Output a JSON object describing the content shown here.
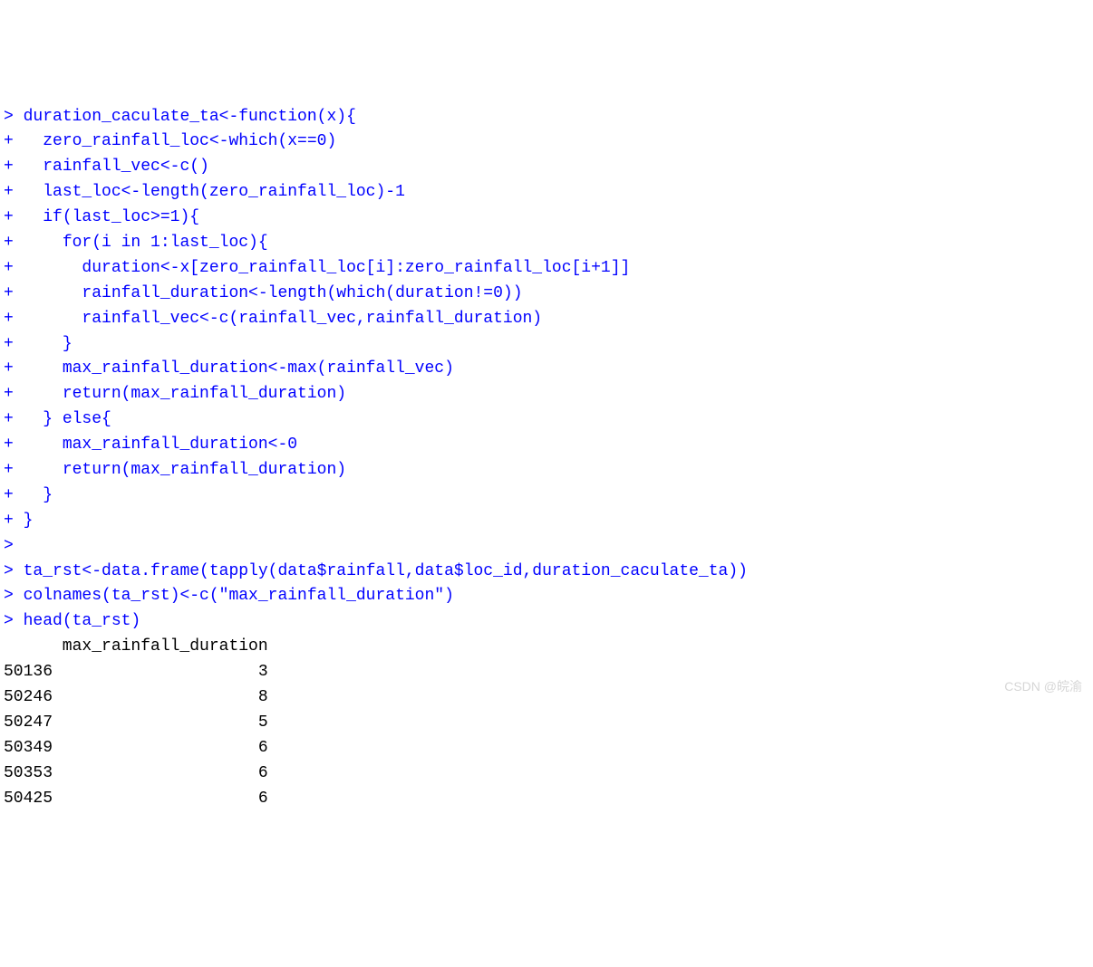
{
  "console": {
    "lines": [
      {
        "prompt": "> ",
        "code": "duration_caculate_ta<-function(x){",
        "output": ""
      },
      {
        "prompt": "+ ",
        "code": "  zero_rainfall_loc<-which(x==0)",
        "output": ""
      },
      {
        "prompt": "+ ",
        "code": "  rainfall_vec<-c()",
        "output": ""
      },
      {
        "prompt": "+ ",
        "code": "  last_loc<-length(zero_rainfall_loc)-1",
        "output": ""
      },
      {
        "prompt": "+ ",
        "code": "  if(last_loc>=1){",
        "output": ""
      },
      {
        "prompt": "+ ",
        "code": "    for(i in 1:last_loc){",
        "output": ""
      },
      {
        "prompt": "+ ",
        "code": "      duration<-x[zero_rainfall_loc[i]:zero_rainfall_loc[i+1]]",
        "output": ""
      },
      {
        "prompt": "+ ",
        "code": "      rainfall_duration<-length(which(duration!=0))",
        "output": ""
      },
      {
        "prompt": "+ ",
        "code": "      rainfall_vec<-c(rainfall_vec,rainfall_duration)",
        "output": ""
      },
      {
        "prompt": "+ ",
        "code": "    }",
        "output": ""
      },
      {
        "prompt": "+ ",
        "code": "    max_rainfall_duration<-max(rainfall_vec)",
        "output": ""
      },
      {
        "prompt": "+ ",
        "code": "    return(max_rainfall_duration)",
        "output": ""
      },
      {
        "prompt": "+ ",
        "code": "  } else{",
        "output": ""
      },
      {
        "prompt": "+ ",
        "code": "    max_rainfall_duration<-0",
        "output": ""
      },
      {
        "prompt": "+ ",
        "code": "    return(max_rainfall_duration)",
        "output": ""
      },
      {
        "prompt": "+ ",
        "code": "  }",
        "output": ""
      },
      {
        "prompt": "+ ",
        "code": "}",
        "output": ""
      },
      {
        "prompt": "> ",
        "code": "",
        "output": ""
      },
      {
        "prompt": "> ",
        "code": "ta_rst<-data.frame(tapply(data$rainfall,data$loc_id,duration_caculate_ta))",
        "output": ""
      },
      {
        "prompt": "> ",
        "code": "colnames(ta_rst)<-c(\"max_rainfall_duration\")",
        "output": ""
      },
      {
        "prompt": "> ",
        "code": "head(ta_rst)",
        "output": ""
      },
      {
        "prompt": "",
        "code": "",
        "output": "      max_rainfall_duration"
      },
      {
        "prompt": "",
        "code": "",
        "output": "50136                     3"
      },
      {
        "prompt": "",
        "code": "",
        "output": "50246                     8"
      },
      {
        "prompt": "",
        "code": "",
        "output": "50247                     5"
      },
      {
        "prompt": "",
        "code": "",
        "output": "50349                     6"
      },
      {
        "prompt": "",
        "code": "",
        "output": "50353                     6"
      },
      {
        "prompt": "",
        "code": "",
        "output": "50425                     6"
      }
    ]
  },
  "chart_data": {
    "type": "table",
    "title": "head(ta_rst)",
    "columns": [
      "",
      "max_rainfall_duration"
    ],
    "rows": [
      [
        "50136",
        3
      ],
      [
        "50246",
        8
      ],
      [
        "50247",
        5
      ],
      [
        "50349",
        6
      ],
      [
        "50353",
        6
      ],
      [
        "50425",
        6
      ]
    ]
  },
  "watermark": "CSDN @皖渝"
}
